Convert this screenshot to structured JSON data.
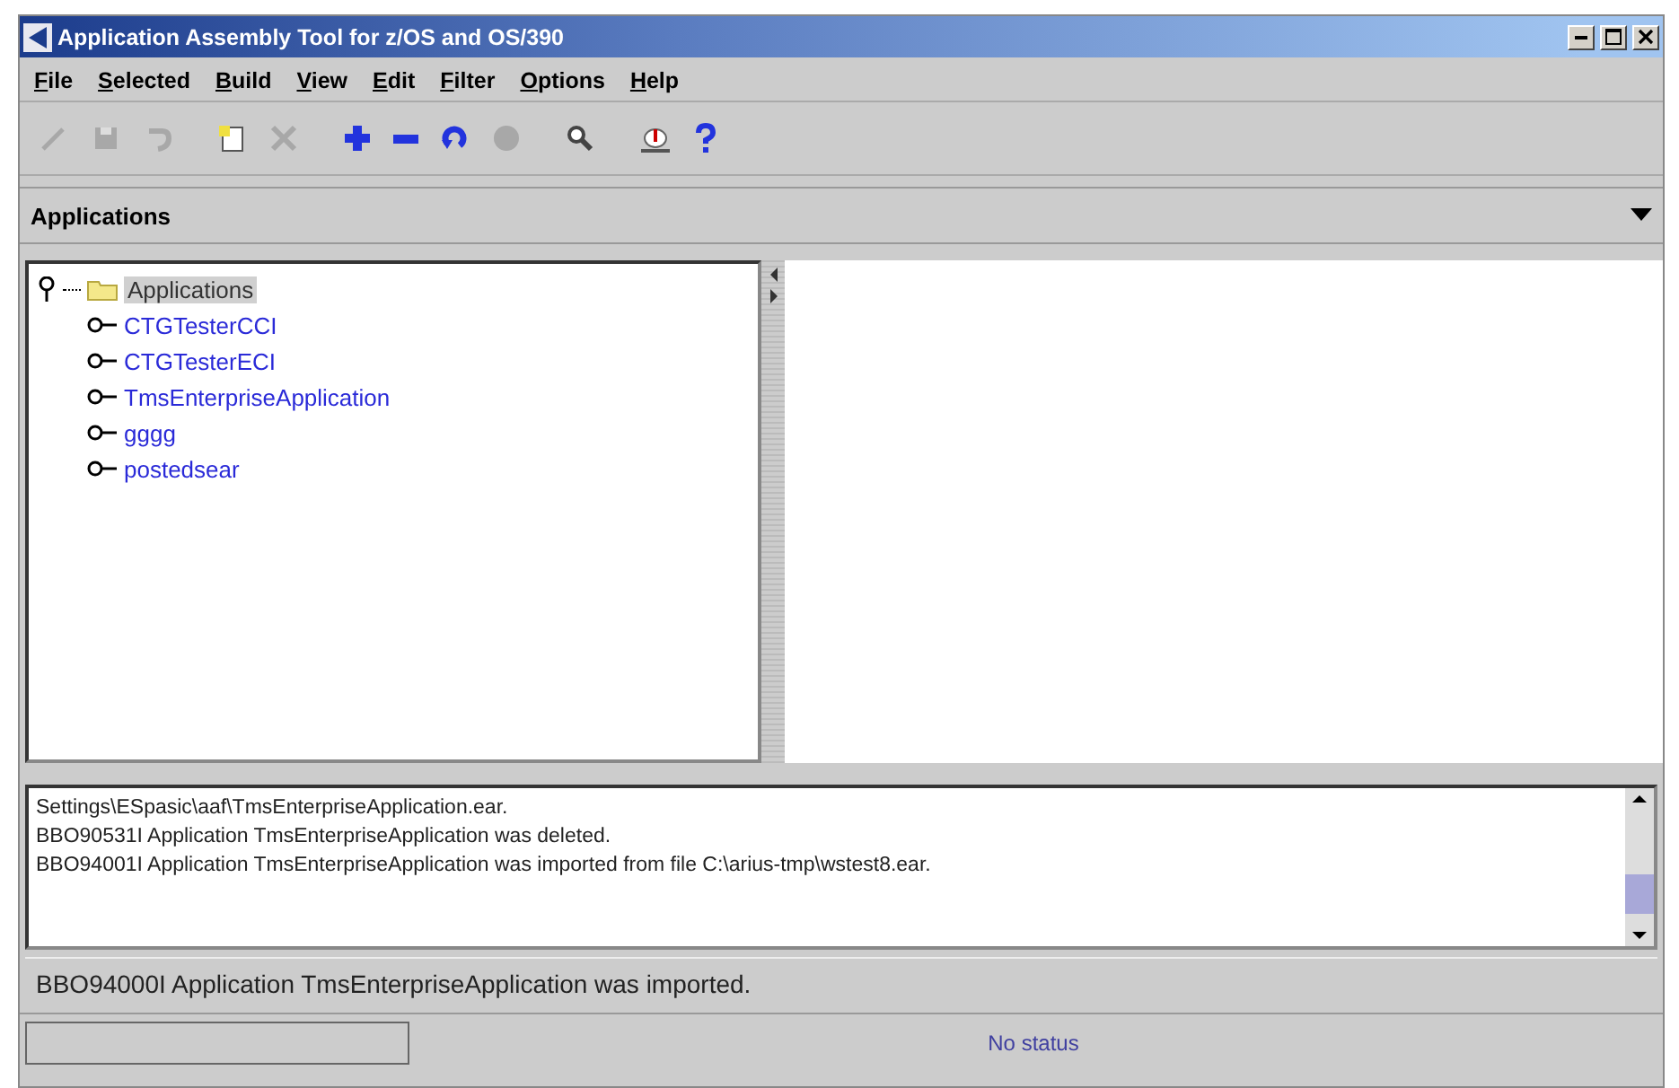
{
  "window": {
    "title": "Application Assembly Tool for z/OS and OS/390"
  },
  "menu": [
    "File",
    "Selected",
    "Build",
    "View",
    "Edit",
    "Filter",
    "Options",
    "Help"
  ],
  "toolbar": [
    {
      "kind": "pencil",
      "disabled": true
    },
    {
      "kind": "save",
      "disabled": true
    },
    {
      "kind": "undo",
      "disabled": true
    },
    {
      "kind": "new",
      "disabled": false
    },
    {
      "kind": "delete",
      "disabled": true
    },
    {
      "kind": "add",
      "disabled": false
    },
    {
      "kind": "remove",
      "disabled": false
    },
    {
      "kind": "refresh",
      "disabled": false
    },
    {
      "kind": "stop",
      "disabled": true
    },
    {
      "kind": "search",
      "disabled": false
    },
    {
      "kind": "export",
      "disabled": false
    },
    {
      "kind": "help",
      "disabled": false
    }
  ],
  "view_header": {
    "title": "Applications"
  },
  "tree": {
    "label": "Applications",
    "expanded": true,
    "selected": true,
    "children": [
      {
        "label": "CTGTesterCCI",
        "expanded": false,
        "selected": false
      },
      {
        "label": "CTGTesterECI",
        "expanded": false,
        "selected": false
      },
      {
        "label": "TmsEnterpriseApplication",
        "expanded": false,
        "selected": false
      },
      {
        "label": "gggg",
        "expanded": false,
        "selected": false
      },
      {
        "label": "postedsear",
        "expanded": false,
        "selected": false
      }
    ]
  },
  "log": [
    "Settings\\ESpasic\\aaf\\TmsEnterpriseApplication.ear.",
    "BBO90531I Application TmsEnterpriseApplication was deleted.",
    "BBO94001I Application TmsEnterpriseApplication was imported from file C:\\arius-tmp\\wstest8.ear."
  ],
  "message": "BBO94000I Application TmsEnterpriseApplication was imported.",
  "status_bar": {
    "progress": {
      "level": 0
    },
    "status": "No status"
  }
}
